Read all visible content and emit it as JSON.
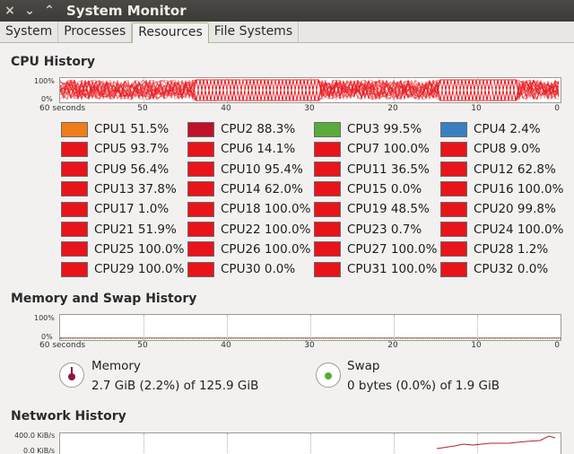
{
  "window": {
    "title": "System Monitor",
    "close_glyph": "×",
    "menu_glyph": "⌄",
    "roll_glyph": "⌃"
  },
  "tabs": [
    {
      "label": "System"
    },
    {
      "label": "Processes"
    },
    {
      "label": "Resources",
      "active": true
    },
    {
      "label": "File Systems"
    }
  ],
  "cpu_history": {
    "title": "CPU History",
    "y_top": "100%",
    "y_bottom": "0%",
    "x_labels": [
      "60 seconds",
      "50",
      "40",
      "30",
      "20",
      "10",
      "0"
    ],
    "cpus": [
      {
        "label": "CPU1 51.5%",
        "color": "#f07c1a"
      },
      {
        "label": "CPU2 88.3%",
        "color": "#c0102a"
      },
      {
        "label": "CPU3 99.5%",
        "color": "#5aab3a"
      },
      {
        "label": "CPU4 2.4%",
        "color": "#3a7fbf"
      },
      {
        "label": "CPU5 93.7%",
        "color": "#e8141a"
      },
      {
        "label": "CPU6 14.1%",
        "color": "#e8141a"
      },
      {
        "label": "CPU7 100.0%",
        "color": "#e8141a"
      },
      {
        "label": "CPU8 9.0%",
        "color": "#e8141a"
      },
      {
        "label": "CPU9 56.4%",
        "color": "#e8141a"
      },
      {
        "label": "CPU10 95.4%",
        "color": "#e8141a"
      },
      {
        "label": "CPU11 36.5%",
        "color": "#e8141a"
      },
      {
        "label": "CPU12 62.8%",
        "color": "#e8141a"
      },
      {
        "label": "CPU13 37.8%",
        "color": "#e8141a"
      },
      {
        "label": "CPU14 62.0%",
        "color": "#e8141a"
      },
      {
        "label": "CPU15 0.0%",
        "color": "#e8141a"
      },
      {
        "label": "CPU16 100.0%",
        "color": "#e8141a"
      },
      {
        "label": "CPU17 1.0%",
        "color": "#e8141a"
      },
      {
        "label": "CPU18 100.0%",
        "color": "#e8141a"
      },
      {
        "label": "CPU19 48.5%",
        "color": "#e8141a"
      },
      {
        "label": "CPU20 99.8%",
        "color": "#e8141a"
      },
      {
        "label": "CPU21 51.9%",
        "color": "#e8141a"
      },
      {
        "label": "CPU22 100.0%",
        "color": "#e8141a"
      },
      {
        "label": "CPU23 0.7%",
        "color": "#e8141a"
      },
      {
        "label": "CPU24 100.0%",
        "color": "#e8141a"
      },
      {
        "label": "CPU25 100.0%",
        "color": "#e8141a"
      },
      {
        "label": "CPU26 100.0%",
        "color": "#e8141a"
      },
      {
        "label": "CPU27 100.0%",
        "color": "#e8141a"
      },
      {
        "label": "CPU28 1.2%",
        "color": "#e8141a"
      },
      {
        "label": "CPU29 100.0%",
        "color": "#e8141a"
      },
      {
        "label": "CPU30 0.0%",
        "color": "#e8141a"
      },
      {
        "label": "CPU31 100.0%",
        "color": "#e8141a"
      },
      {
        "label": "CPU32 0.0%",
        "color": "#e8141a"
      }
    ]
  },
  "memory_history": {
    "title": "Memory and Swap History",
    "y_top": "100%",
    "y_bottom": "0%",
    "x_labels": [
      "60 seconds",
      "50",
      "40",
      "30",
      "20",
      "10",
      "0"
    ],
    "memory": {
      "label": "Memory",
      "value": "2.7 GiB (2.2%) of 125.9 GiB",
      "color": "#8b1a3a"
    },
    "swap": {
      "label": "Swap",
      "value": "0 bytes (0.0%) of 1.9 GiB",
      "color": "#5aab3a"
    }
  },
  "network_history": {
    "title": "Network History",
    "y_top": "400.0 KiB/s",
    "y_bottom": "0.0 KiB/s"
  }
}
